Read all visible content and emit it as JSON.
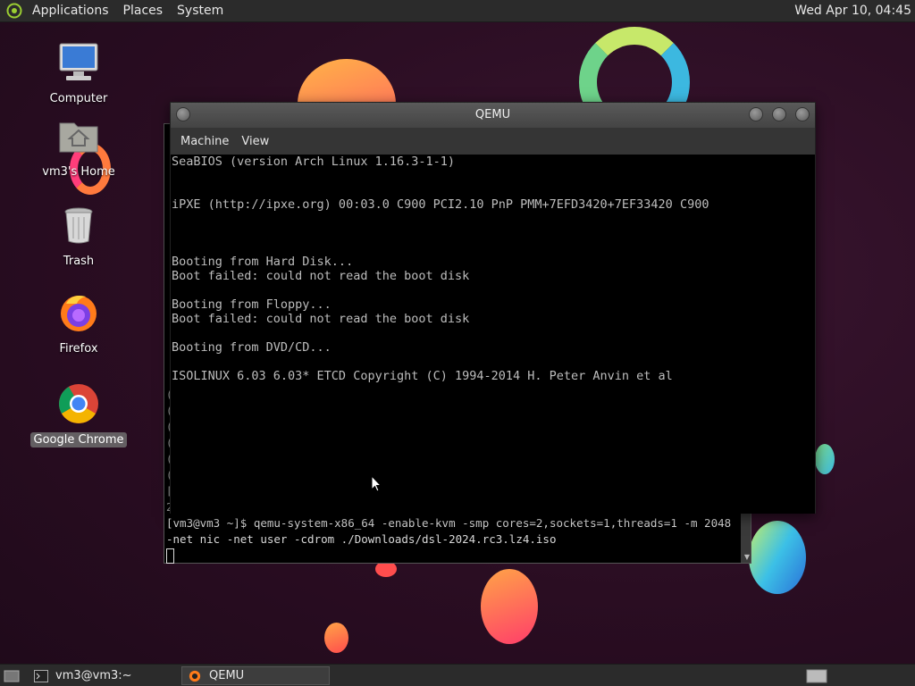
{
  "top_panel": {
    "menus": [
      "Applications",
      "Places",
      "System"
    ],
    "clock": "Wed Apr 10, 04:45"
  },
  "desktop_icons": [
    {
      "label": "Computer",
      "icon": "computer-icon"
    },
    {
      "label": "vm3's Home",
      "icon": "home-folder-icon"
    },
    {
      "label": "Trash",
      "icon": "trash-icon"
    },
    {
      "label": "Firefox",
      "icon": "firefox-icon"
    },
    {
      "label": "Google Chrome",
      "icon": "chrome-icon",
      "selected": true
    }
  ],
  "terminal": {
    "lines": [
      "[vm3@vm3 ~]$ qemu-system-x86_64 -enable-kvm -smp cores=2,sockets=1,threads=1 -m 2048 -net nic -net user -cdrom ./Downloads/dsl-2024.rc3.lz4.iso"
    ],
    "fragments": [
      "(",
      "(",
      "(",
      "(",
      "(",
      "(",
      "[",
      "2"
    ]
  },
  "qemu": {
    "title": "QEMU",
    "menus": [
      "Machine",
      "View"
    ],
    "screen_lines": [
      "SeaBIOS (version Arch Linux 1.16.3-1-1)",
      "iPXE (http://ipxe.org) 00:03.0 C900 PCI2.10 PnP PMM+7EFD3420+7EF33420 C900",
      "Booting from Hard Disk...",
      "Boot failed: could not read the boot disk",
      "Booting from Floppy...",
      "Boot failed: could not read the boot disk",
      "Booting from DVD/CD...",
      "ISOLINUX 6.03 6.03* ETCD Copyright (C) 1994-2014 H. Peter Anvin et al"
    ]
  },
  "taskbar": {
    "tasks": [
      {
        "label": "vm3@vm3:~",
        "icon": "terminal-icon"
      },
      {
        "label": "QEMU",
        "icon": "qemu-icon",
        "active": true
      }
    ]
  },
  "colors": {
    "accent_orange": "#ff8a3d",
    "accent_pink": "#ff3d7a",
    "accent_cyan": "#3dc8e8",
    "panel": "#2b2b2b"
  }
}
